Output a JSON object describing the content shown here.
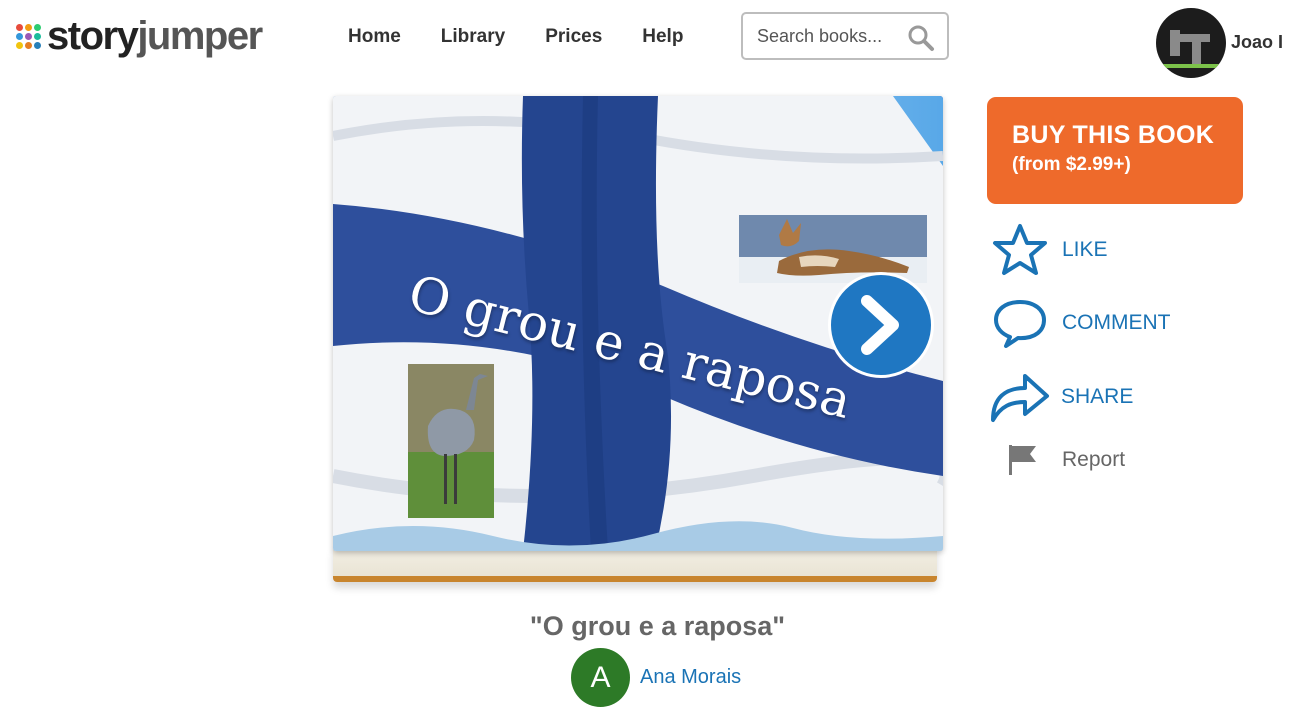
{
  "header": {
    "logo": {
      "part1": "story",
      "part2": "jumper",
      "dot_colors": [
        "#e74c3c",
        "#f39c12",
        "#2ecc71",
        "#3498db",
        "#9b59b6",
        "#1abc9c",
        "#f1c40f",
        "#e67e22",
        "#2980b9"
      ]
    },
    "nav": [
      {
        "label": "Home"
      },
      {
        "label": "Library"
      },
      {
        "label": "Prices"
      },
      {
        "label": "Help"
      }
    ],
    "search": {
      "placeholder": "Search books..."
    },
    "user": {
      "name": "Joao I"
    }
  },
  "book": {
    "cover_title": "O grou e a raposa",
    "title": "\"O grou e a raposa\"",
    "author": {
      "initial": "A",
      "name": "Ana Morais"
    }
  },
  "actions": {
    "buy": {
      "title": "BUY THIS BOOK",
      "subtitle": "(from $2.99+)"
    },
    "like": "LIKE",
    "comment": "COMMENT",
    "share": "SHARE",
    "report": "Report"
  },
  "colors": {
    "accent_orange": "#ee6a2b",
    "link_blue": "#1a73b5",
    "flag_blue": "#2a57a8",
    "author_green": "#2d7a27"
  }
}
